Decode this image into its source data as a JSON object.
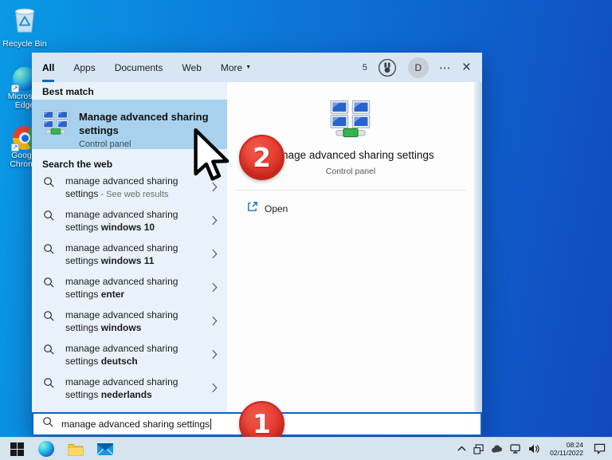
{
  "window": {
    "tabs": [
      {
        "label": "All",
        "active": true
      },
      {
        "label": "Apps"
      },
      {
        "label": "Documents"
      },
      {
        "label": "Web"
      },
      {
        "label": "More",
        "dropdown": true
      }
    ],
    "rewards_count": "5",
    "avatar_initial": "D"
  },
  "left_panel": {
    "best_match_header": "Best match",
    "best_match": {
      "title": "Manage advanced sharing settings",
      "subtitle": "Control panel"
    },
    "search_web_header": "Search the web",
    "suggestions": [
      {
        "normal": "manage advanced sharing settings",
        "bold": "",
        "muted": " - See web results"
      },
      {
        "normal": "manage advanced sharing settings ",
        "bold": "windows 10",
        "muted": ""
      },
      {
        "normal": "manage advanced sharing settings ",
        "bold": "windows 11",
        "muted": ""
      },
      {
        "normal": "manage advanced sharing settings ",
        "bold": "enter",
        "muted": ""
      },
      {
        "normal": "manage advanced sharing settings ",
        "bold": "windows",
        "muted": ""
      },
      {
        "normal": "manage advanced sharing settings ",
        "bold": "deutsch",
        "muted": ""
      },
      {
        "normal": "manage advanced sharing settings ",
        "bold": "nederlands",
        "muted": ""
      }
    ]
  },
  "right_panel": {
    "title": "Manage advanced sharing settings",
    "subtitle": "Control panel",
    "open_label": "Open"
  },
  "search_box": {
    "value": "manage advanced sharing settings"
  },
  "annotations": {
    "step1": "1",
    "step2": "2"
  },
  "desktop": {
    "icons": [
      {
        "label": "Recycle Bin"
      },
      {
        "label": "Microsoft Edge"
      },
      {
        "label": "Google Chrome"
      }
    ]
  },
  "taskbar": {
    "time": "08:24",
    "date": "02/11/2022"
  },
  "colors": {
    "accent": "#0b6cbd",
    "highlight": "#a8d1ee",
    "badge_red": "#e63a2e",
    "desktop_blue_left": "#0a9ae6",
    "desktop_blue_right": "#1148c0"
  }
}
